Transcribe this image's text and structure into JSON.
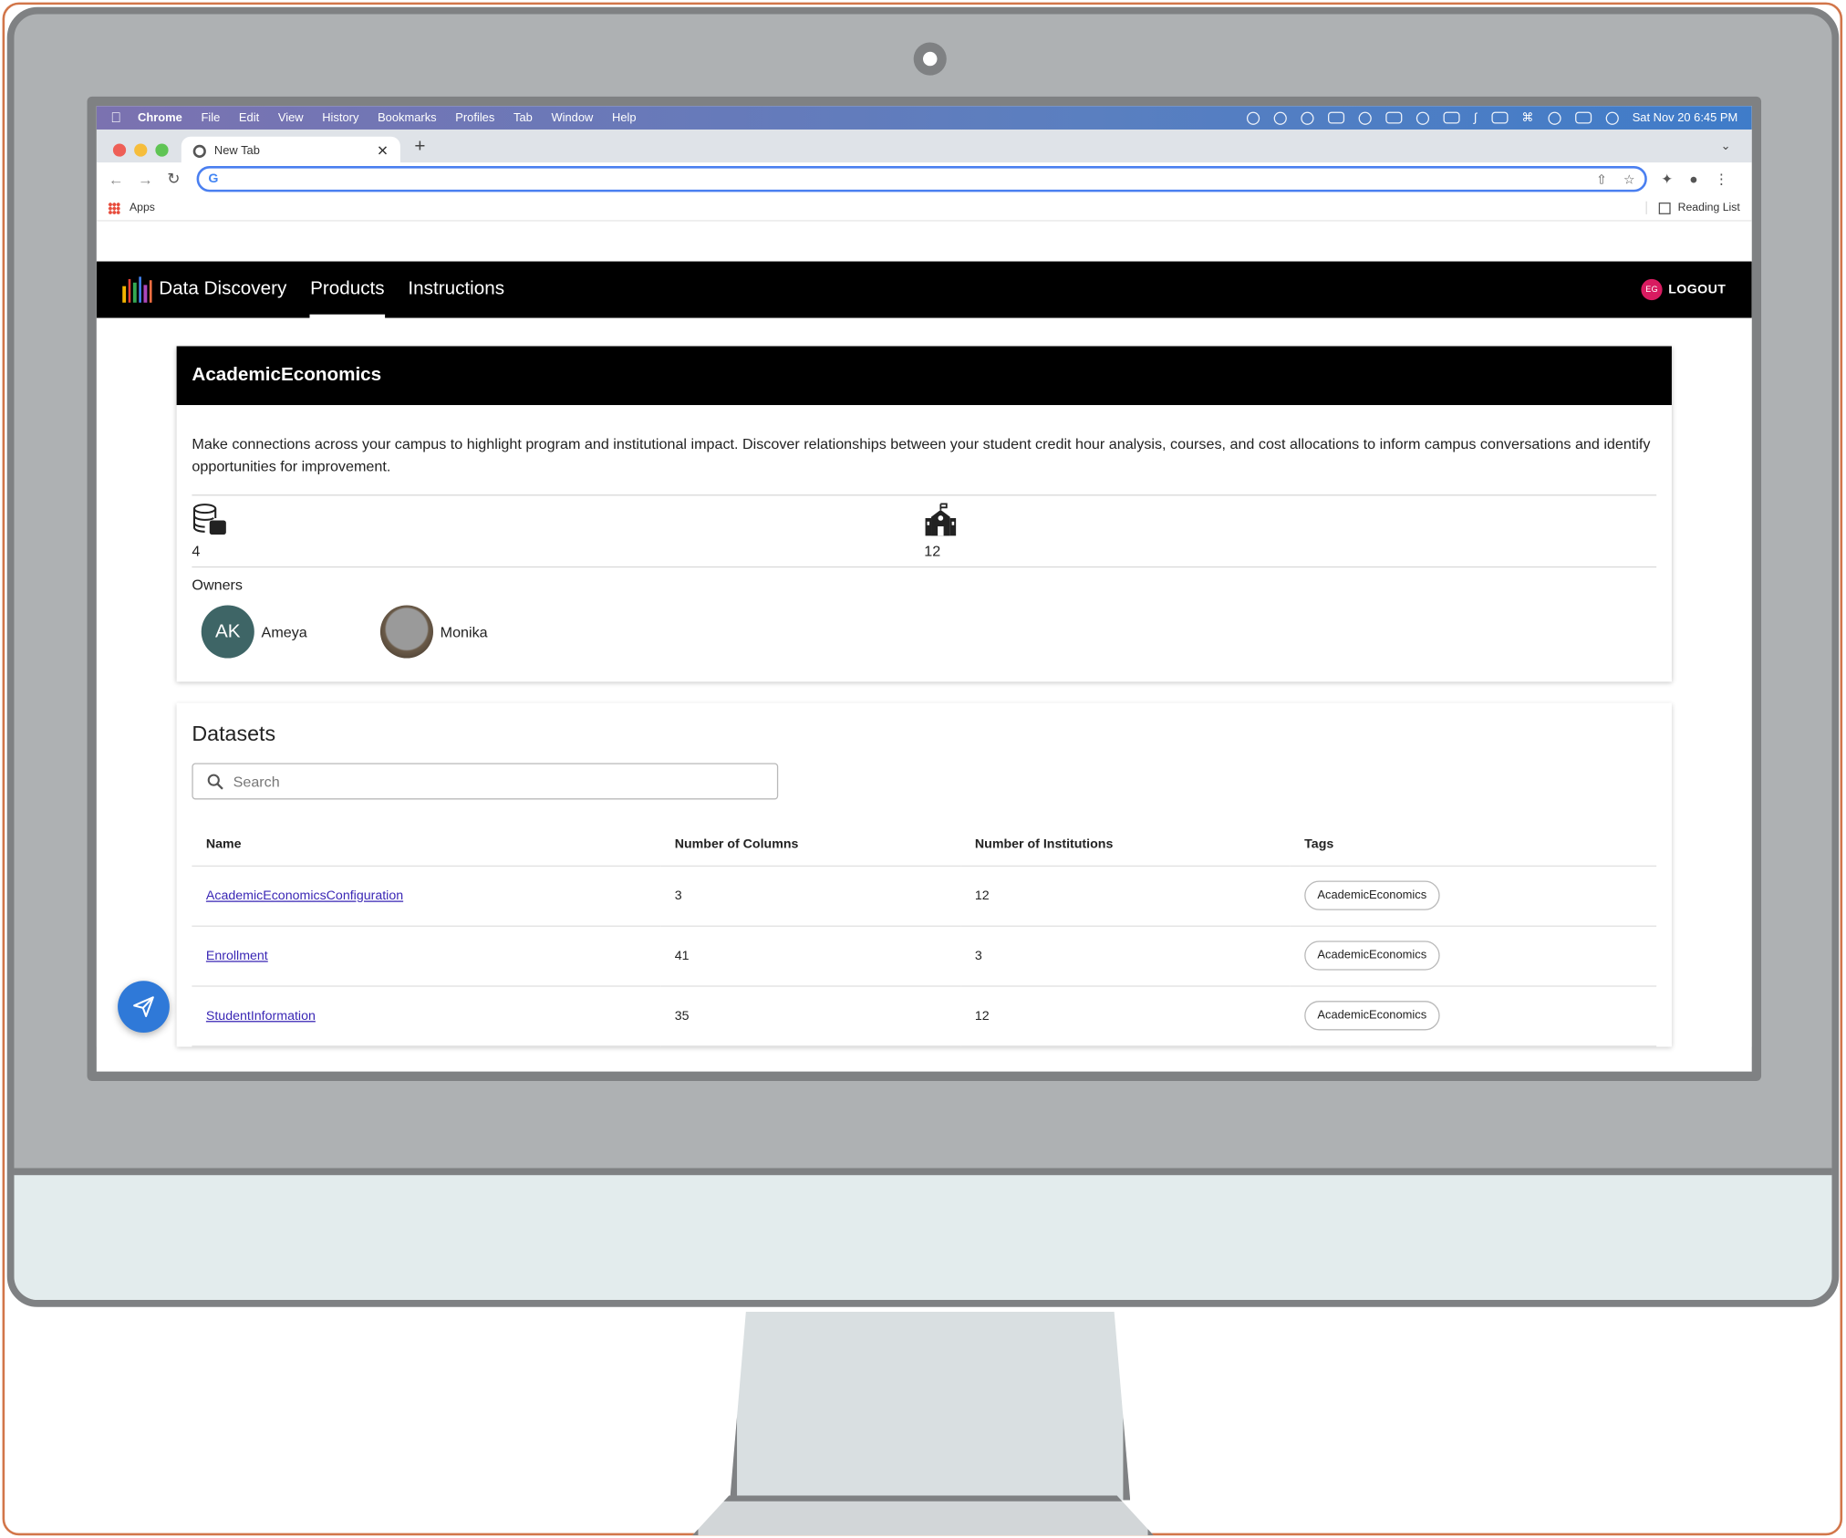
{
  "menubar": {
    "app": "Chrome",
    "items": [
      "File",
      "Edit",
      "View",
      "History",
      "Bookmarks",
      "Profiles",
      "Tab",
      "Window",
      "Help"
    ],
    "datetime": "Sat Nov 20  6:45 PM"
  },
  "browser": {
    "tab_title": "New Tab",
    "address_value": "",
    "bookmarks_apps": "Apps",
    "reading_list": "Reading List"
  },
  "appbar": {
    "brand": "Data Discovery",
    "nav": [
      "Products",
      "Instructions"
    ],
    "active_nav": "Products",
    "user_initials": "EG",
    "logout": "LOGOUT",
    "logo_colors": [
      "#f4b400",
      "#e94235",
      "#34a853",
      "#4285f4",
      "#ab47bc",
      "#ff7043"
    ]
  },
  "product": {
    "title": "AcademicEconomics",
    "description": "Make connections across your campus to highlight program and institutional impact. Discover relationships between your student credit hour analysis, courses, and cost allocations to inform campus conversations and identify opportunities for improvement.",
    "datasets_count": "4",
    "institutions_count": "12",
    "owners_label": "Owners",
    "owners": [
      {
        "initials": "AK",
        "name": "Ameya"
      },
      {
        "initials": "",
        "name": "Monika"
      }
    ]
  },
  "datasets": {
    "title": "Datasets",
    "search_placeholder": "Search",
    "columns": [
      "Name",
      "Number of Columns",
      "Number of Institutions",
      "Tags"
    ],
    "rows": [
      {
        "name": "AcademicEconomicsConfiguration",
        "columns": "3",
        "institutions": "12",
        "tag": "AcademicEconomics"
      },
      {
        "name": "Enrollment",
        "columns": "41",
        "institutions": "3",
        "tag": "AcademicEconomics"
      },
      {
        "name": "StudentInformation",
        "columns": "35",
        "institutions": "12",
        "tag": "AcademicEconomics"
      }
    ]
  },
  "colors": {
    "appbar_bg": "#000000",
    "link": "#3a27b5",
    "fab": "#2f79d8",
    "avatar_ak": "#3e6566",
    "user_badge": "#d81b60",
    "frame_accent": "#d2764a"
  },
  "icons": {
    "datasets_stat": "database-icon",
    "institutions_stat": "school-building-icon",
    "search": "search-icon",
    "fab": "send-icon"
  }
}
